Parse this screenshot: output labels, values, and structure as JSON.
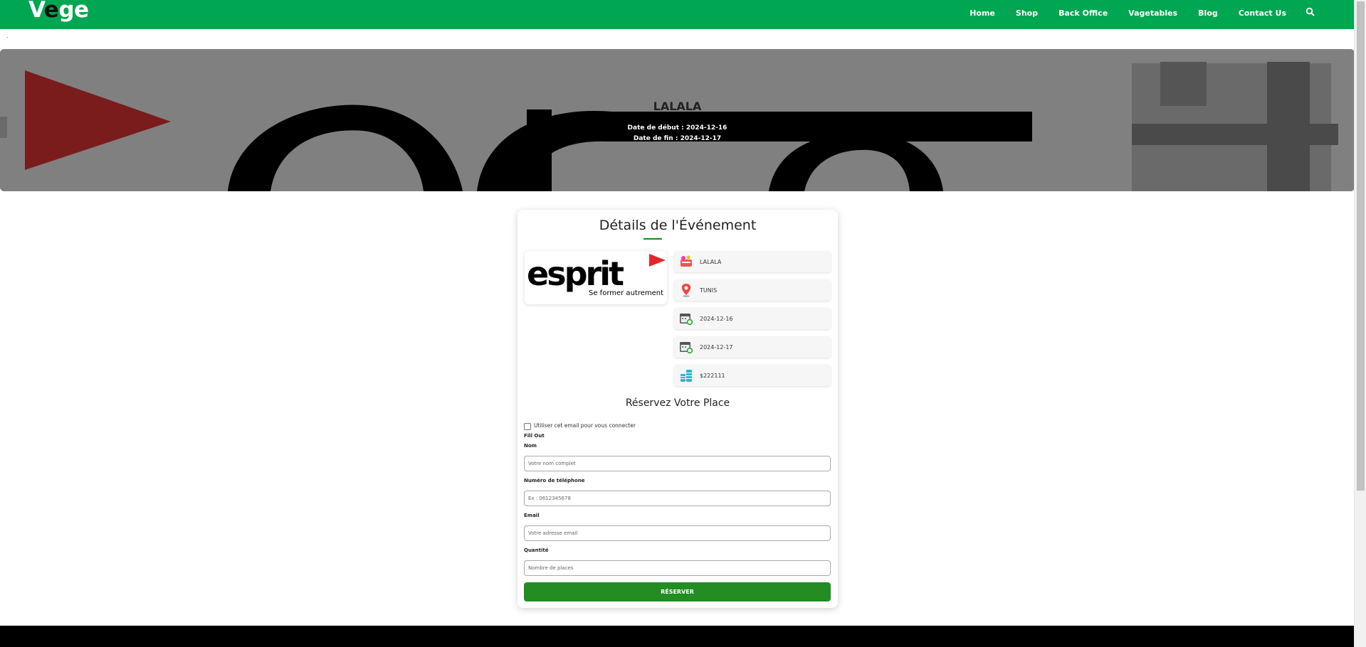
{
  "brand": {
    "logo_part1": "V",
    "logo_part2": "e",
    "logo_part3": "ge"
  },
  "nav": {
    "items": [
      "Home",
      "Shop",
      "Back Office",
      "Vagetables",
      "Blog",
      "Contact Us"
    ]
  },
  "page_dot": ".",
  "hero": {
    "title": "LALALA",
    "date_start": "Date de début : 2024-12-16",
    "date_end": "Date de fin : 2024-12-17"
  },
  "card": {
    "title": "Détails de l'Événement",
    "logo_text": "esprit",
    "logo_tagline": "Se former autrement",
    "info": [
      {
        "icon": "event-icon",
        "value": "LALALA"
      },
      {
        "icon": "location-pin-icon",
        "value": "TUNIS"
      },
      {
        "icon": "calendar-icon",
        "value": "2024-12-16"
      },
      {
        "icon": "calendar-icon",
        "value": "2024-12-17"
      },
      {
        "icon": "coins-icon",
        "value": "$222111"
      }
    ]
  },
  "form": {
    "title": "Réservez Votre Place",
    "checkbox_label": "Utiliser cet email pour vous connecter",
    "fill_out": "Fill Out",
    "name_label": "Nom",
    "name_placeholder": "Votre nom complet",
    "phone_label": "Numéro de téléphone",
    "phone_placeholder": "Ex : 0612345678",
    "email_label": "Email",
    "email_placeholder": "Votre adresse email",
    "qty_label": "Quantité",
    "qty_placeholder": "Nombre de places",
    "submit_label": "RÉSERVER"
  },
  "colors": {
    "header": "#00a651",
    "button": "#238c23",
    "accent_red": "#e3262a"
  }
}
